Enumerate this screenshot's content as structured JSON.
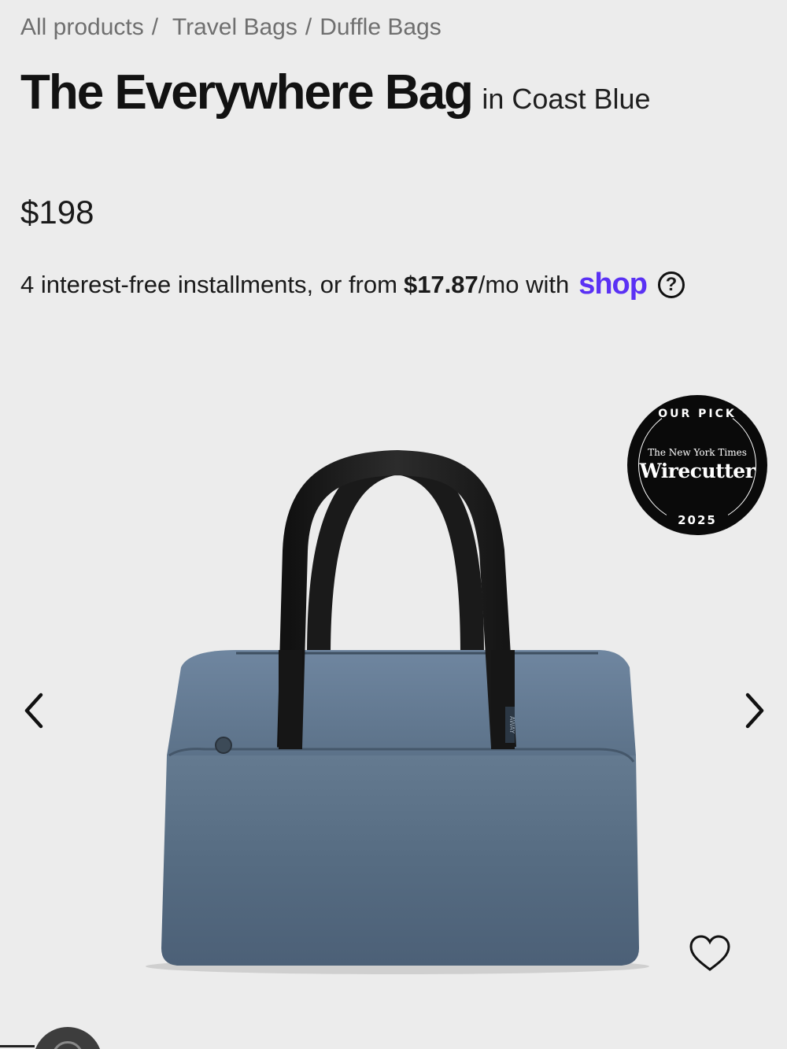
{
  "breadcrumb": {
    "items": [
      "All products",
      "Travel Bags",
      "Duffle Bags"
    ],
    "separator": "/"
  },
  "product": {
    "title": "The Everywhere Bag",
    "color_text": "in Coast Blue",
    "price": "$198"
  },
  "installments": {
    "text": "4 interest-free installments, or from",
    "amount": "$17.87",
    "suffix": "/mo with",
    "brand": "shop",
    "help_icon": "question-circle-icon"
  },
  "badge": {
    "top": "OUR PICK",
    "publisher": "The New York Times",
    "name": "Wirecutter",
    "year": "2025"
  },
  "gallery": {
    "prev_icon": "chevron-left-icon",
    "next_icon": "chevron-right-icon",
    "bag_label": "AWAY",
    "favorite_icon": "heart-icon",
    "chat_icon": "chat-icon"
  },
  "colors": {
    "background": "#ececec",
    "bag_body": "#556a7f",
    "strap": "#1b1b1b",
    "shop_purple": "#5a31f4",
    "breadcrumb_gray": "#6f6f6f"
  }
}
